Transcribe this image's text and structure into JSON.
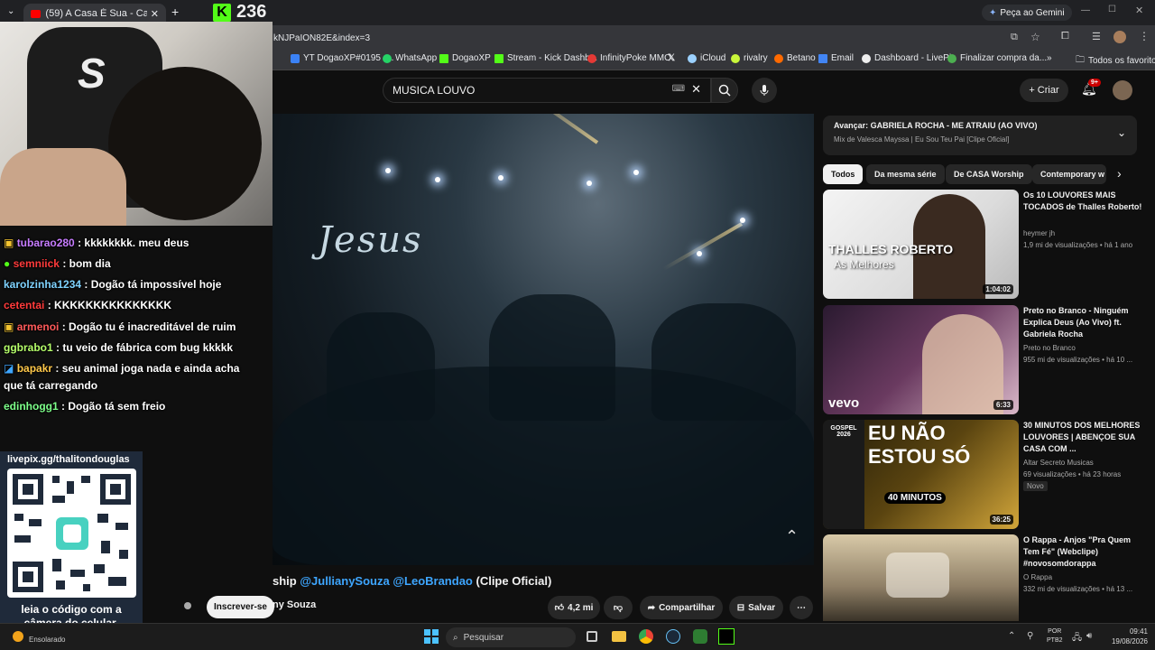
{
  "browser": {
    "tab_title": "(59) A Casa É Sua - Casa W",
    "url": "kNJPaION82E&index=3",
    "gemini_label": "Peça ao Gemini",
    "bookmarks": [
      "YT DogaoXP#0195 -...",
      "WhatsApp",
      "DogaoXP",
      "Stream - Kick Dashb...",
      "InfinityPoke MMO",
      "iCloud",
      "rivalry",
      "Betano",
      "Email",
      "Dashboard - LivePix",
      "Finalizar compra da..."
    ],
    "all_favorites": "Todos os favoritos"
  },
  "kick": {
    "viewer_count": "236"
  },
  "youtube": {
    "search_value": "MUSICA LOUVO",
    "create_label": "Criar",
    "notif_badge": "9+",
    "video_overlay_text": "Jesus",
    "title_visible": "ship @JullianySouza @LeoBrandao (Clipe Oficial)",
    "title_plain": "ship ",
    "title_link1": "@JullianySouza",
    "title_link2": "@LeoBrandao",
    "title_tail": " (Clipe Oficial)",
    "channel_fragment": "ny Souza",
    "subscribe_label": "Inscrever-se",
    "likes": "4,2 mi",
    "share_label": "Compartilhar",
    "save_label": "Salvar",
    "queue": {
      "next_label": "Avançar: GABRIELA ROCHA - ME ATRAIU (AO VIVO)",
      "mix_label": "Mix de Valesca Mayssa | Eu Sou Teu Pai [Clipe Oficial]"
    },
    "chips": [
      "Todos",
      "Da mesma série",
      "De CASA Worship",
      "Contemporary w"
    ],
    "recommendations": [
      {
        "title": "Os 10 LOUVORES MAIS TOCADOS de Thalles Roberto!",
        "channel": "heymer jh",
        "meta": "1,9 mi de visualizações • há 1 ano",
        "duration": "1:04:02",
        "thumb_text1": "THALLES ROBERTO",
        "thumb_text2": "As Melhores"
      },
      {
        "title": "Preto no Branco - Ninguém Explica Deus (Ao Vivo) ft. Gabriela Rocha",
        "channel": "Preto no Branco",
        "meta": "955 mi de visualizações • há 10 ...",
        "duration": "6:33",
        "thumb_text1": "vevo"
      },
      {
        "title": "30 MINUTOS DOS MELHORES LOUVORES | ABENÇOE SUA CASA COM ...",
        "channel": "Altar Secreto Musicas",
        "meta": "69 visualizações • há 23 horas",
        "badge": "Novo",
        "duration": "36:25",
        "thumb_text1": "EU NÃO",
        "thumb_text2": "ESTOU SÓ",
        "thumb_text3": "40 MINUTOS",
        "thumb_text4": "GOSPEL 2026"
      },
      {
        "title": "O Rappa - Anjos \"Pra Quem Tem Fé\" (Webclipe) #novosomdorappa",
        "channel": "O Rappa",
        "meta": "332 mi de visualizações • há 13 ..."
      }
    ]
  },
  "chat": [
    {
      "user": "tubarao280",
      "text": ": kkkkkkkk. meu deus",
      "color": "#c77dff"
    },
    {
      "user": "semniick",
      "text": ": bom dia",
      "color": "#ff3b3b"
    },
    {
      "user": "karolzinha1234",
      "text": ": Dogão tá impossível hoje",
      "color": "#7fd3ff"
    },
    {
      "user": "cetentai",
      "text": ": KKKKKKKKKKKKKKK",
      "color": "#ff3b3b"
    },
    {
      "user": "armenoi",
      "text": ": Dogão tu é inacreditável de ruim",
      "color": "#ff5a5a"
    },
    {
      "user": "ggbrabo1",
      "text": ": tu veio de fábrica com bug kkkkk",
      "color": "#b6ff6b"
    },
    {
      "user": "bapakr",
      "text": ": seu animal joga nada e ainda acha",
      "color": "#ffc84a",
      "cont": "que tá carregando"
    },
    {
      "user": "edinhogg1",
      "text": ": Dogão tá sem freio",
      "color": "#7dff8a"
    }
  ],
  "livepix": {
    "url": "livepix.gg/thalitondouglas",
    "caption_line1": "leia o código com a",
    "caption_line2": "câmera do celular."
  },
  "taskbar": {
    "weather": "Ensolarado",
    "search_placeholder": "Pesquisar",
    "lang1": "POR",
    "lang2": "PTB2",
    "time": "09:41",
    "date": "19/08/2026"
  }
}
